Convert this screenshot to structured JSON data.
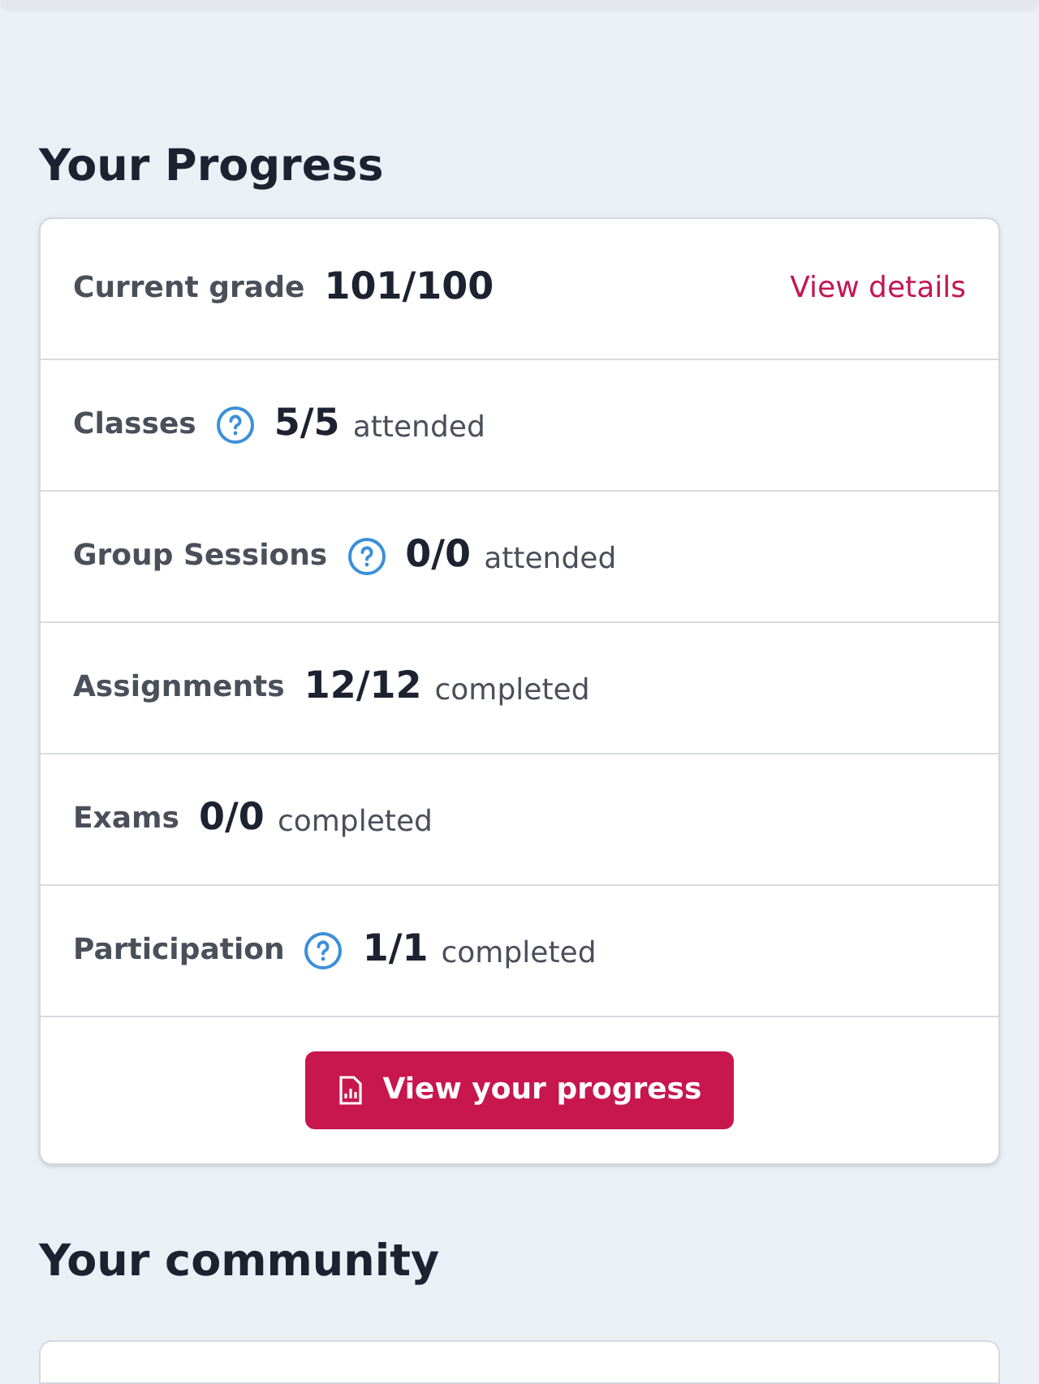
{
  "progress": {
    "title": "Your Progress",
    "rows": [
      {
        "label": "Current grade",
        "help": false,
        "value": "101/100",
        "suffix": "",
        "link": "View details"
      },
      {
        "label": "Classes",
        "help": true,
        "value": "5/5",
        "suffix": "attended"
      },
      {
        "label": "Group Sessions",
        "help": true,
        "value": "0/0",
        "suffix": "attended"
      },
      {
        "label": "Assignments",
        "help": false,
        "value": "12/12",
        "suffix": "completed"
      },
      {
        "label": "Exams",
        "help": false,
        "value": "0/0",
        "suffix": "completed"
      },
      {
        "label": "Participation",
        "help": true,
        "value": "1/1",
        "suffix": "completed"
      }
    ],
    "button": "View your progress"
  },
  "community": {
    "title": "Your community"
  }
}
